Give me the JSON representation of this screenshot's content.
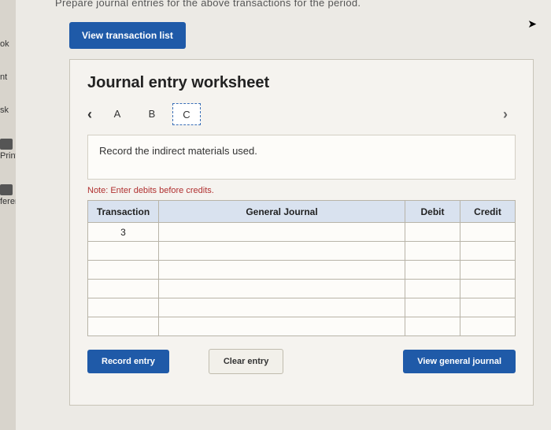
{
  "top_fragment": "Prepare journal entries for the above transactions for the period.",
  "sidebar": {
    "items": [
      "ok",
      "nt",
      "sk",
      "Print",
      "ferences"
    ]
  },
  "buttons": {
    "view_list": "View transaction list",
    "record": "Record entry",
    "clear": "Clear entry",
    "view_journal": "View general journal"
  },
  "worksheet": {
    "title": "Journal entry worksheet",
    "tabs": [
      "A",
      "B",
      "C"
    ],
    "selected_tab": "C",
    "prompt": "Record the indirect materials used.",
    "note": "Note: Enter debits before credits.",
    "headers": {
      "transaction": "Transaction",
      "general_journal": "General Journal",
      "debit": "Debit",
      "credit": "Credit"
    },
    "transaction_number": "3"
  }
}
